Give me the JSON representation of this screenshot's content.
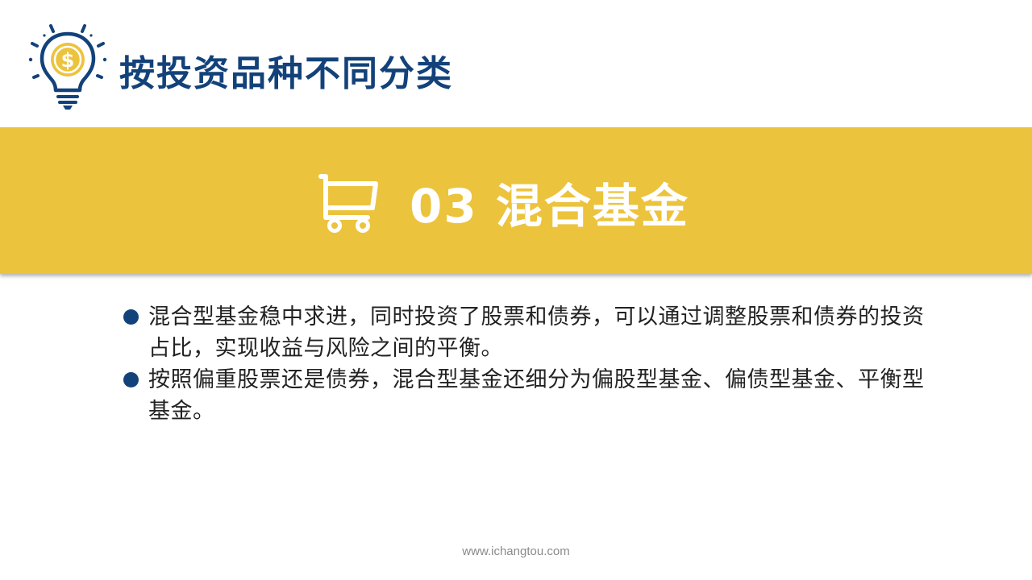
{
  "header": {
    "title": "按投资品种不同分类",
    "logo_icon": "lightbulb-dollar-icon"
  },
  "banner": {
    "icon": "shopping-cart-icon",
    "title": "03 混合基金"
  },
  "bullets": [
    "混合型基金稳中求进，同时投资了股票和债券，可以通过调整股票和债券的投资占比，实现收益与风险之间的平衡。",
    "按照偏重股票还是债券，混合型基金还细分为偏股型基金、偏债型基金、平衡型基金。"
  ],
  "footer": {
    "url": "www.ichangtou.com"
  },
  "colors": {
    "navy": "#13427a",
    "gold": "#ecc33c",
    "text": "#222222",
    "footer": "#8a8a8a"
  }
}
